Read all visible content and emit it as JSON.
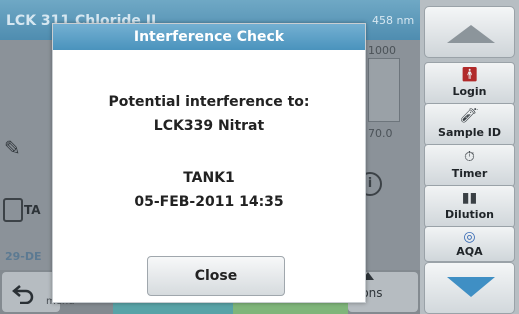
{
  "background": {
    "title": "LCK 311 Chloride II",
    "wavelength": "458 nm",
    "scale_top": "1000",
    "scale_bottom": "70.0",
    "sample_text": "TA",
    "date_partial": "29-DE",
    "back_label": "menu",
    "options_label": "ions"
  },
  "dialog": {
    "title": "Interference Check",
    "line1": "Potential interference to:",
    "line2": "LCK339 Nitrat",
    "line3": "TANK1",
    "line4": "05-FEB-2011  14:35",
    "close_label": "Close"
  },
  "sidebar": {
    "buttons": [
      {
        "label": "Login",
        "icon": "person-icon"
      },
      {
        "label": "Sample ID",
        "icon": "sample-icon"
      },
      {
        "label": "Timer",
        "icon": "timer-icon"
      },
      {
        "label": "Dilution",
        "icon": "dilution-icon"
      },
      {
        "label": "AQA",
        "icon": "aqa-icon"
      }
    ]
  },
  "colors": {
    "title_bar": "#4f8db0",
    "dialog_title": "#4a93bd",
    "nav_down_arrow": "#3f8fc4"
  }
}
